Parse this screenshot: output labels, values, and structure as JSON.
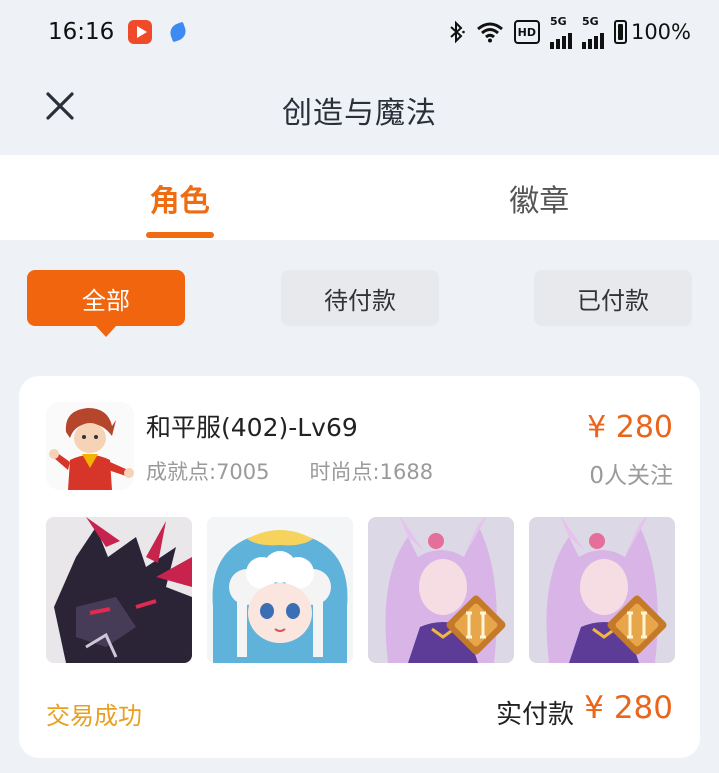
{
  "status_bar": {
    "time": "16:16",
    "battery": "100%",
    "signal_label_1": "5G",
    "signal_label_2": "5G",
    "hd_label": "HD",
    "icons": [
      "video-app-icon",
      "blue-app-icon",
      "bluetooth-icon",
      "wifi-icon",
      "hd-icon",
      "signal-icon",
      "signal-icon",
      "battery-icon"
    ]
  },
  "header": {
    "title": "创造与魔法",
    "close_icon": "close-icon"
  },
  "tabs": [
    {
      "label": "角色",
      "active": true
    },
    {
      "label": "徽章",
      "active": false
    }
  ],
  "filters": [
    {
      "label": "全部",
      "active": true
    },
    {
      "label": "待付款",
      "active": false
    },
    {
      "label": "已付款",
      "active": false
    }
  ],
  "order": {
    "server_name": "和平服(402)-Lv69",
    "achievement": "成就点:7005",
    "fashion": "时尚点:1688",
    "price": "¥ 280",
    "follows": "0人关注",
    "skins": [
      "dragon-mount",
      "cloud-hat-doll",
      "fox-girl-skin",
      "fox-girl-skin"
    ],
    "status": "交易成功",
    "paid_label": "实付款",
    "paid_amount": "¥ 280"
  },
  "colors": {
    "accent": "#ef6c13",
    "status": "#e9a020",
    "background": "#eef1f5"
  }
}
